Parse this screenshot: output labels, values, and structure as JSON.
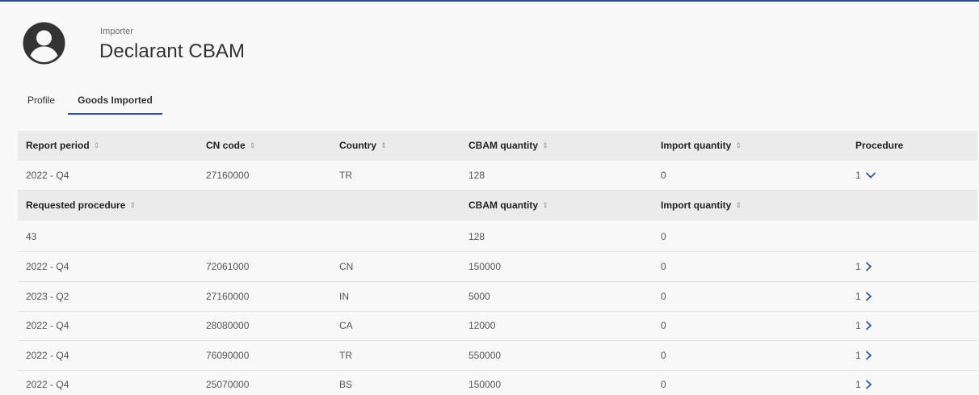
{
  "header": {
    "eyebrow": "Importer",
    "title": "Declarant CBAM",
    "avatar_icon": "user-circle-icon"
  },
  "tabs": [
    {
      "label": "Profile",
      "active": false
    },
    {
      "label": "Goods Imported",
      "active": true
    }
  ],
  "table": {
    "columns": [
      "Report period",
      "CN code",
      "Country",
      "CBAM quantity",
      "Import quantity",
      "Procedure"
    ],
    "expanded_row": {
      "report_period": "2022 - Q4",
      "cn_code": "27160000",
      "country": "TR",
      "cbam_quantity": "128",
      "import_quantity": "0",
      "procedure": "1"
    },
    "sub_columns": [
      "Requested procedure",
      "CBAM quantity",
      "Import quantity"
    ],
    "sub_row": {
      "requested_procedure": "43",
      "cbam_quantity": "128",
      "import_quantity": "0"
    },
    "rows": [
      {
        "report_period": "2022 - Q4",
        "cn_code": "72061000",
        "country": "CN",
        "cbam_quantity": "150000",
        "import_quantity": "0",
        "procedure": "1"
      },
      {
        "report_period": "2023 - Q2",
        "cn_code": "27160000",
        "country": "IN",
        "cbam_quantity": "5000",
        "import_quantity": "0",
        "procedure": "1"
      },
      {
        "report_period": "2022 - Q4",
        "cn_code": "28080000",
        "country": "CA",
        "cbam_quantity": "12000",
        "import_quantity": "0",
        "procedure": "1"
      },
      {
        "report_period": "2022 - Q4",
        "cn_code": "76090000",
        "country": "TR",
        "cbam_quantity": "550000",
        "import_quantity": "0",
        "procedure": "1"
      },
      {
        "report_period": "2022 - Q4",
        "cn_code": "25070000",
        "country": "BS",
        "cbam_quantity": "150000",
        "import_quantity": "0",
        "procedure": "1"
      }
    ]
  },
  "colors": {
    "accent": "#2f5597",
    "header_bg": "#ebebeb",
    "page_bg": "#f8f8f8"
  },
  "icons": {
    "sort": "sort-icon",
    "expand": "chevron-down-icon",
    "open": "chevron-right-icon"
  }
}
